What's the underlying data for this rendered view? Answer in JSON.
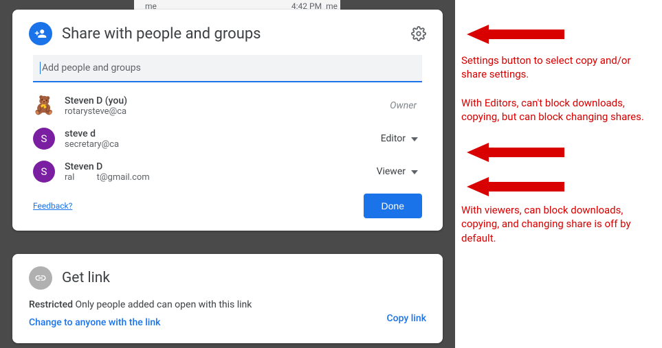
{
  "bg": {
    "sender": "me",
    "time": "4:42 PM",
    "me2": "me"
  },
  "share": {
    "title": "Share with people and groups",
    "placeholder": "Add people and groups",
    "people": [
      {
        "name": "Steven D (you)",
        "email": "rotarysteve@ca",
        "role": "Owner"
      },
      {
        "name": "steve d",
        "email": "secretary@ca",
        "role": "Editor"
      },
      {
        "name": "Steven D",
        "email": "ral          t@gmail.com",
        "role": "Viewer"
      }
    ],
    "feedback": "Feedback?",
    "done": "Done"
  },
  "link": {
    "title": "Get link",
    "restricted_label": "Restricted",
    "restricted_text": " Only people added can open with this link",
    "change": "Change to anyone with the link",
    "copy": "Copy link"
  },
  "annotations": {
    "a1": "Settings button to select copy and/or share settings.",
    "a2": "With Editors, can't block downloads, copying, but can block changing shares.",
    "a3": "With viewers, can block downloads, copying, and changing share is off by default."
  }
}
